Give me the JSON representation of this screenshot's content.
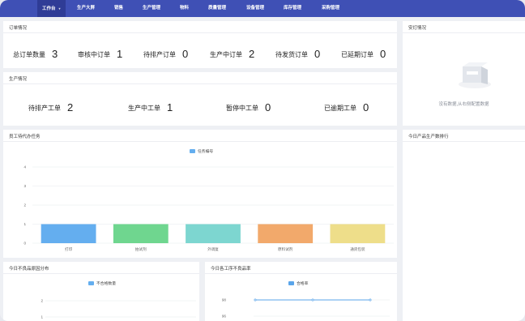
{
  "nav": {
    "items": [
      {
        "label": "工作台",
        "active": true,
        "caret": "▾"
      },
      {
        "label": "生产大屏"
      },
      {
        "label": "销售"
      },
      {
        "label": "生产管理"
      },
      {
        "label": "物料"
      },
      {
        "label": "质量管理"
      },
      {
        "label": "设备管理"
      },
      {
        "label": "库存管理"
      },
      {
        "label": "采购管理"
      }
    ]
  },
  "order_overview": {
    "title": "订单情况",
    "stats": [
      {
        "label": "总订单数量",
        "value": "3"
      },
      {
        "label": "审核中订单",
        "value": "1"
      },
      {
        "label": "待排产订单",
        "value": "0"
      },
      {
        "label": "生产中订单",
        "value": "2"
      },
      {
        "label": "待发货订单",
        "value": "0"
      },
      {
        "label": "已延期订单",
        "value": "0"
      }
    ]
  },
  "production_overview": {
    "title": "生产情况",
    "stats": [
      {
        "label": "待排产工单",
        "value": "2"
      },
      {
        "label": "生产中工单",
        "value": "1"
      },
      {
        "label": "暂停中工单",
        "value": "0"
      },
      {
        "label": "已逾期工单",
        "value": "0"
      }
    ]
  },
  "installation": {
    "title": "安灯情况",
    "empty_text": "没有数据,从右侧配置数据"
  },
  "tasks": {
    "title": "员工待代办任务"
  },
  "ranking": {
    "title": "今日产品生产数排行"
  },
  "defect_causes": {
    "title": "今日不良品原因分布"
  },
  "defect_rate": {
    "title": "今日各工序不良品率"
  },
  "colors": {
    "nav_bg": "#3f50b5",
    "bar_blue": "#64aeef",
    "bar_green": "#6fd68f",
    "bar_teal": "#7dd6d0",
    "bar_orange": "#f2a96b",
    "bar_yellow": "#eede8a",
    "line_blue": "#5aa5ea"
  },
  "chart_data": [
    {
      "type": "bar",
      "legend": [
        "任务编号"
      ],
      "legend_position": "top-center",
      "categories": [
        "打印",
        "拍试剂",
        "外调复",
        "原料试剂",
        "通货包装"
      ],
      "values": [
        1,
        1,
        1,
        1,
        1
      ],
      "y_ticks": [
        "0",
        "1",
        "2",
        "3",
        "4"
      ],
      "ylim": [
        0,
        4
      ],
      "grid": true
    },
    {
      "type": "bar",
      "legend": [
        "不合格数量"
      ],
      "legend_position": "top-center",
      "categories": [],
      "values": [],
      "y_ticks": [
        "1",
        "2"
      ],
      "grid": true
    },
    {
      "type": "line",
      "legend": [
        "合格率"
      ],
      "legend_position": "top-center",
      "categories": [
        "",
        "",
        ""
      ],
      "values": [
        98,
        98,
        98
      ],
      "y_ticks": [
        "96",
        "98"
      ],
      "grid": true
    }
  ]
}
